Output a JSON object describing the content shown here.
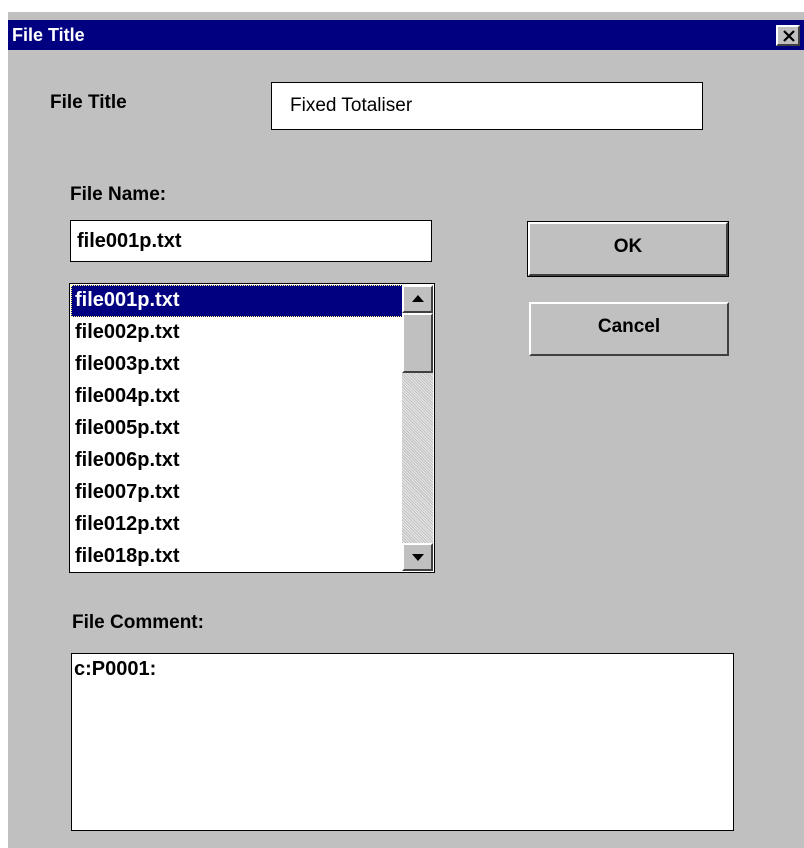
{
  "window": {
    "title": "File Title"
  },
  "form": {
    "file_title_label": "File Title",
    "file_title_value": "Fixed Totaliser",
    "file_name_label": "File Name:",
    "file_name_value": "file001p.txt",
    "file_comment_label": "File Comment:",
    "file_comment_value": "c:P0001:"
  },
  "file_list": {
    "items": [
      "file001p.txt",
      "file002p.txt",
      "file003p.txt",
      "file004p.txt",
      "file005p.txt",
      "file006p.txt",
      "file007p.txt",
      "file012p.txt",
      "file018p.txt"
    ],
    "selected_index": 0
  },
  "buttons": {
    "ok_label": "OK",
    "cancel_label": "Cancel"
  },
  "colors": {
    "titlebar": "#000080",
    "window_bg": "#c0c0c0",
    "selection": "#000080"
  },
  "icons": {
    "close": "close-icon",
    "scroll_up": "scroll-up-arrow-icon",
    "scroll_down": "scroll-down-arrow-icon"
  }
}
